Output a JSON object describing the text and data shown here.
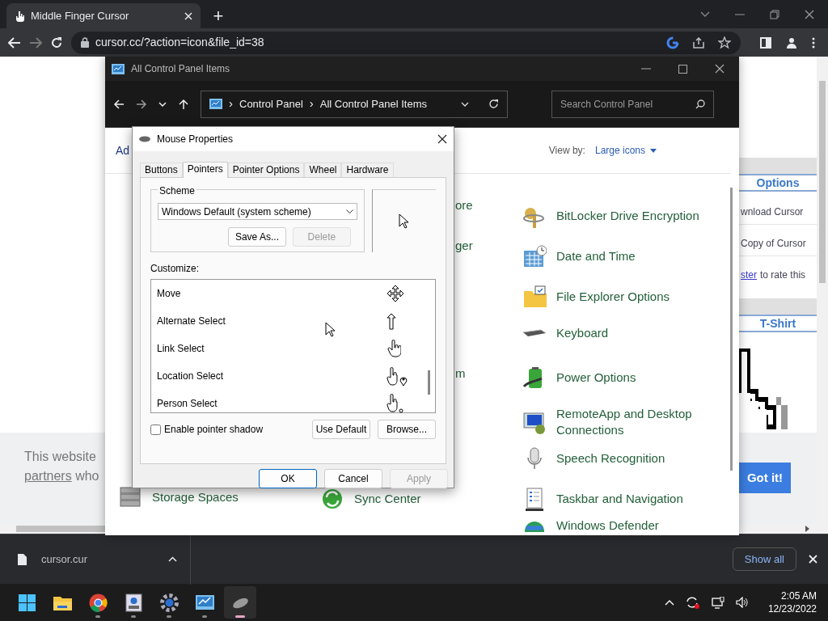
{
  "browser": {
    "tab_title": "Middle Finger Cursor",
    "new_tab": "+",
    "url": "cursor.cc/?action=icon&file_id=38"
  },
  "web_page": {
    "sidebar": [
      {
        "kind": "header",
        "text": "Options"
      },
      {
        "kind": "link",
        "text": "wnload Cursor"
      },
      {
        "kind": "link",
        "text": "Copy of Cursor"
      },
      {
        "kind": "rate",
        "link": "ster",
        "text": "to rate this"
      },
      {
        "kind": "header",
        "text": "T-Shirt"
      }
    ],
    "cookie_banner": {
      "text": "This website",
      "link": "partners",
      "text2": "who",
      "button": "Got it!"
    }
  },
  "control_panel": {
    "title": "All Control Panel Items",
    "breadcrumb": [
      "Control Panel",
      "All Control Panel Items"
    ],
    "breadcrumb_separator": "›",
    "search_placeholder": "Search Control Panel",
    "heading": "Ad",
    "view_by_label": "View by:",
    "view_by_value": "Large icons",
    "rows": [
      {
        "middle": "ore",
        "right": "BitLocker Drive Encryption"
      },
      {
        "middle": "ger",
        "right": "Date and Time"
      },
      {
        "right": "File Explorer Options"
      },
      {
        "right": "Keyboard"
      },
      {
        "middle": "m",
        "right": "Power Options"
      },
      {
        "right": "RemoteApp and Desktop Connections"
      },
      {
        "right": "Speech Recognition"
      },
      {
        "left": "Storage Spaces",
        "middle": "Sync Center",
        "right": "Taskbar and Navigation"
      },
      {
        "right": "Windows Defender"
      }
    ]
  },
  "mouse_dialog": {
    "title": "Mouse Properties",
    "tabs": [
      {
        "label": "Buttons",
        "selected": false
      },
      {
        "label": "Pointers",
        "selected": true
      },
      {
        "label": "Pointer Options",
        "selected": false
      },
      {
        "label": "Wheel",
        "selected": false
      },
      {
        "label": "Hardware",
        "selected": false
      }
    ],
    "scheme": {
      "legend": "Scheme",
      "value": "Windows Default (system scheme)",
      "buttons": [
        {
          "label": "Save As...",
          "disabled": false
        },
        {
          "label": "Delete",
          "disabled": true
        }
      ]
    },
    "customize_label": "Customize:",
    "pointers": [
      {
        "name": "Move"
      },
      {
        "name": "Alternate Select"
      },
      {
        "name": "Link Select"
      },
      {
        "name": "Location Select"
      },
      {
        "name": "Person Select"
      }
    ],
    "shadow": {
      "label": "Enable pointer shadow",
      "checked": false
    },
    "list_buttons": [
      "Use Default",
      "Browse..."
    ],
    "footer_buttons": [
      {
        "label": "OK",
        "default": true,
        "disabled": false
      },
      {
        "label": "Cancel",
        "default": false,
        "disabled": false
      },
      {
        "label": "Apply",
        "default": false,
        "disabled": true
      }
    ]
  },
  "download_bar": {
    "file": "cursor.cur",
    "show_all": "Show all"
  },
  "taskbar": {
    "apps": [
      {
        "running": false,
        "active": false
      },
      {
        "running": false,
        "active": false
      },
      {
        "running": true,
        "active": false
      },
      {
        "running": true,
        "active": false
      },
      {
        "running": true,
        "active": false
      },
      {
        "running": true,
        "active": false
      },
      {
        "running": true,
        "active": true
      }
    ],
    "time": "2:05 AM",
    "date": "12/23/2022"
  }
}
